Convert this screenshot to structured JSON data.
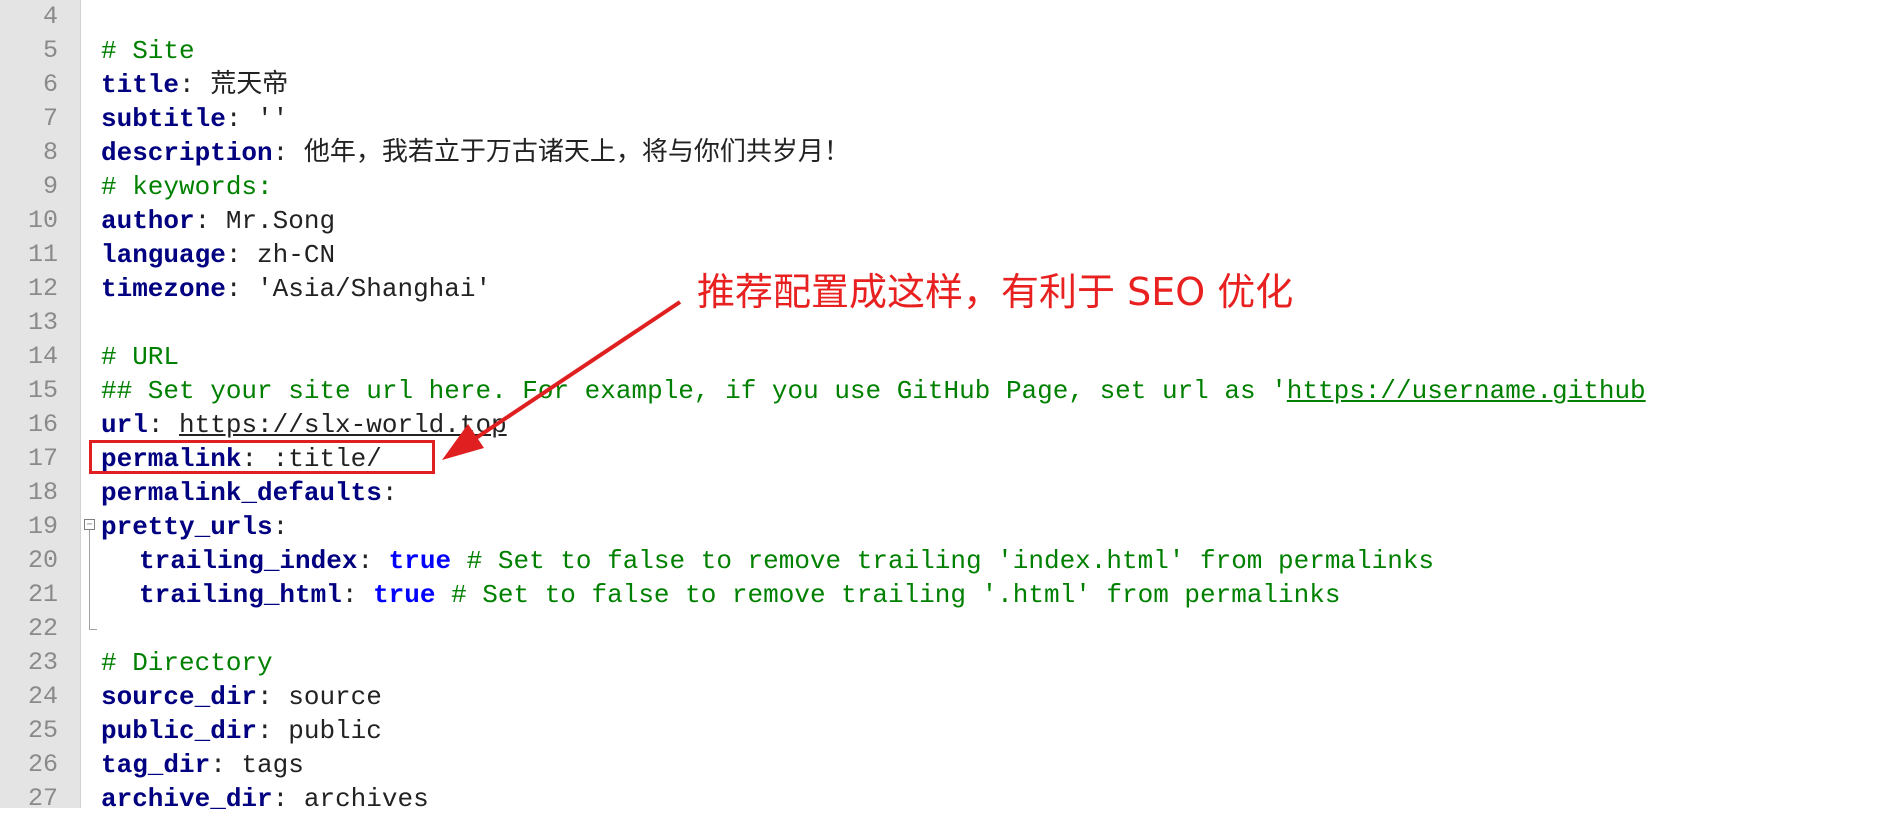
{
  "editor": {
    "lines": [
      {
        "no": "4"
      },
      {
        "no": "5",
        "comment": "# Site"
      },
      {
        "no": "6",
        "key": "title",
        "sep": ": ",
        "value": "荒天帝"
      },
      {
        "no": "7",
        "key": "subtitle",
        "sep": ": ",
        "value": "''"
      },
      {
        "no": "8",
        "key": "description",
        "sep": ": ",
        "value": "他年，我若立于万古诸天上，将与你们共岁月！"
      },
      {
        "no": "9",
        "comment": "# keywords:"
      },
      {
        "no": "10",
        "key": "author",
        "sep": ": ",
        "value": "Mr.Song"
      },
      {
        "no": "11",
        "key": "language",
        "sep": ": ",
        "value": "zh-CN"
      },
      {
        "no": "12",
        "key": "timezone",
        "sep": ": ",
        "value": "'Asia/Shanghai'"
      },
      {
        "no": "13"
      },
      {
        "no": "14",
        "comment": "# URL"
      },
      {
        "no": "15",
        "comment_prefix": "## Set your site url here. For example, if you use GitHub Page, set url as '",
        "comment_link": "https://username.github"
      },
      {
        "no": "16",
        "key": "url",
        "sep": ": ",
        "link": "https://slx-world.top"
      },
      {
        "no": "17",
        "key": "permalink",
        "sep": ": ",
        "value": ":title/"
      },
      {
        "no": "18",
        "key": "permalink_defaults",
        "sep": ":"
      },
      {
        "no": "19",
        "key": "pretty_urls",
        "sep": ":"
      },
      {
        "no": "20",
        "key": "trailing_index",
        "sep": ": ",
        "bool": "true",
        "comment": " # Set to false to remove trailing 'index.html' from permalinks"
      },
      {
        "no": "21",
        "key": "trailing_html",
        "sep": ": ",
        "bool": "true",
        "comment": " # Set to false to remove trailing '.html' from permalinks"
      },
      {
        "no": "22"
      },
      {
        "no": "23",
        "comment": "# Directory"
      },
      {
        "no": "24",
        "key": "source_dir",
        "sep": ": ",
        "value": "source"
      },
      {
        "no": "25",
        "key": "public_dir",
        "sep": ": ",
        "value": "public"
      },
      {
        "no": "26",
        "key": "tag_dir",
        "sep": ": ",
        "value": "tags"
      },
      {
        "no": "27",
        "key": "archive_dir",
        "sep": ": ",
        "value": "archives"
      }
    ]
  },
  "annotation": {
    "text": "推荐配置成这样，有利于 SEO 优化",
    "color": "#e82020"
  },
  "colors": {
    "gutter": "#e4e4e4",
    "key": "#000080",
    "comment": "#008000",
    "bool": "#0000ff"
  }
}
